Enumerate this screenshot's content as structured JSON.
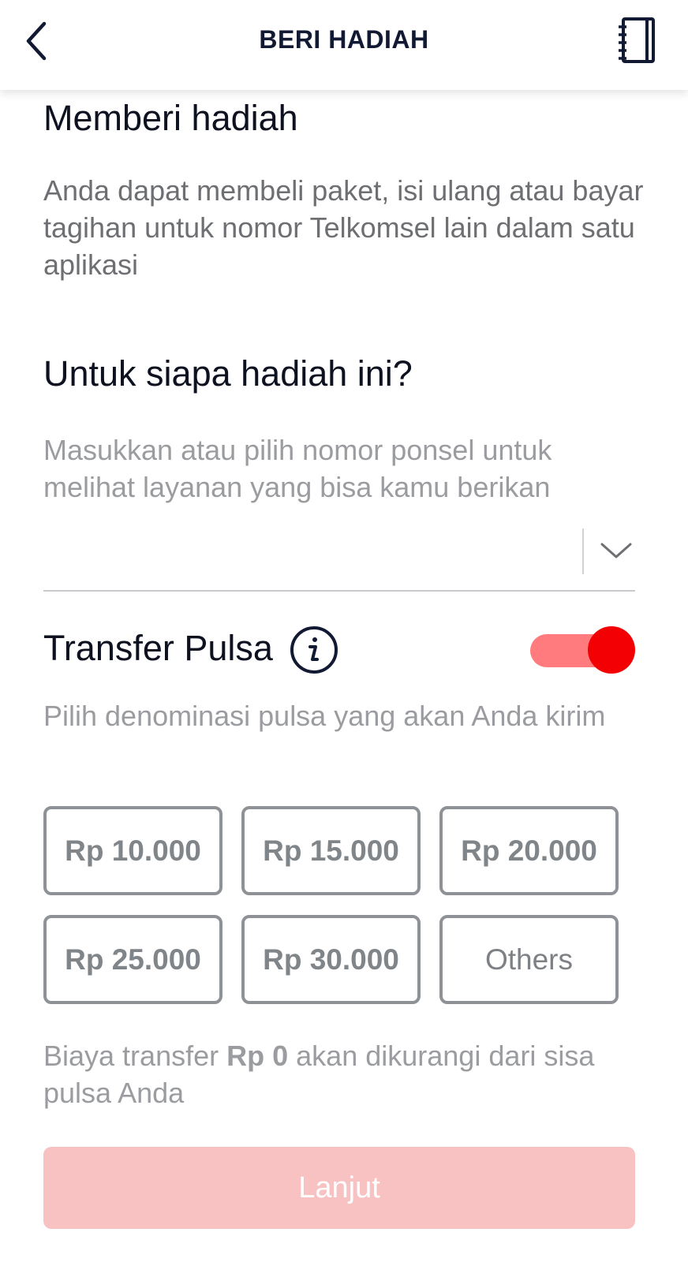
{
  "header": {
    "title": "BERI HADIAH",
    "back_icon": "chevron-left-icon",
    "address_book_icon": "address-book-icon"
  },
  "intro": {
    "title": "Memberi hadiah",
    "description": "Anda dapat membeli paket, isi ulang atau bayar tagihan untuk nomor Telkomsel lain dalam satu aplikasi"
  },
  "recipient": {
    "title": "Untuk siapa hadiah ini?",
    "description": "Masukkan atau pilih nomor ponsel untuk melihat layanan yang bisa kamu berikan",
    "phone_value": "",
    "dropdown_icon": "chevron-down-icon"
  },
  "transfer": {
    "label": "Transfer Pulsa",
    "info_icon": "info-icon",
    "toggle_on": true,
    "toggle_colors": {
      "track": "#ff7b7d",
      "knob": "#f20004"
    },
    "description": "Pilih denominasi pulsa yang akan Anda kirim",
    "denominations": [
      "Rp 10.000",
      "Rp 15.000",
      "Rp 20.000",
      "Rp 25.000",
      "Rp 30.000",
      "Others"
    ]
  },
  "fee": {
    "prefix": "Biaya transfer",
    "amount": "Rp 0",
    "suffix": "akan dikurangi dari sisa pulsa Anda"
  },
  "next_button": {
    "label": "Lanjut",
    "color": "#f8c2c2",
    "enabled": false
  }
}
